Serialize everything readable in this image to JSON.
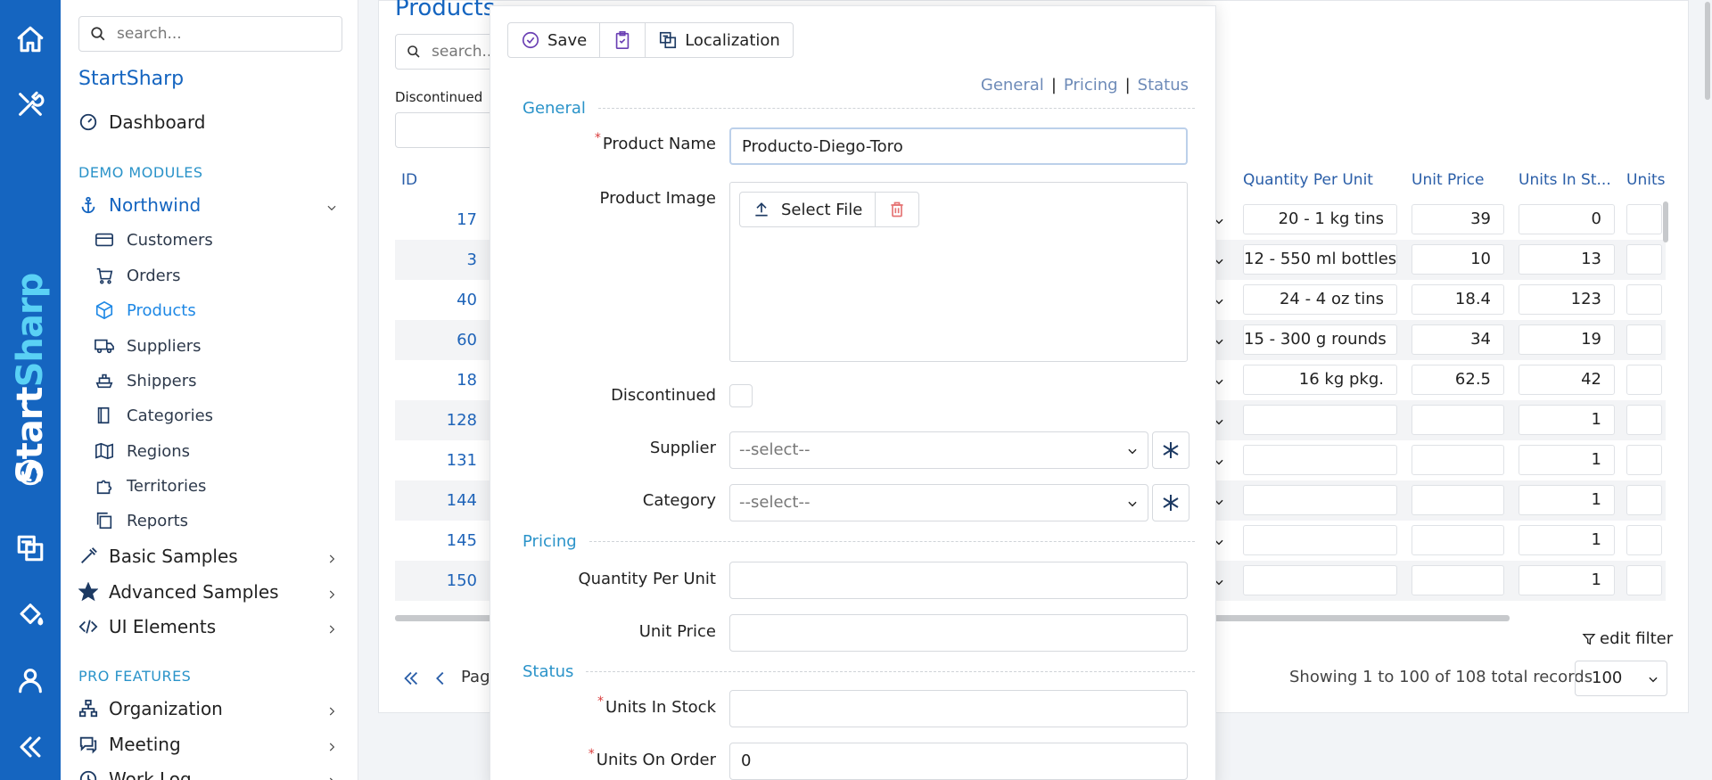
{
  "rail": {
    "brand_part1": "Start",
    "brand_part2": "Sharp",
    "icons": [
      "home-icon",
      "tools-icon",
      "translate-icon",
      "paint-bucket-icon",
      "user-icon",
      "collapse-icon"
    ]
  },
  "sidebar": {
    "search_placeholder": "search...",
    "brand": "StartSharp",
    "dashboard": "Dashboard",
    "section_demo": "DEMO MODULES",
    "northwind": "Northwind",
    "sub_items": [
      {
        "label": "Customers",
        "icon": "credit-card-icon"
      },
      {
        "label": "Orders",
        "icon": "cart-icon"
      },
      {
        "label": "Products",
        "icon": "box-icon"
      },
      {
        "label": "Suppliers",
        "icon": "truck-icon"
      },
      {
        "label": "Shippers",
        "icon": "ship-icon"
      },
      {
        "label": "Categories",
        "icon": "book-icon"
      },
      {
        "label": "Regions",
        "icon": "map-icon"
      },
      {
        "label": "Territories",
        "icon": "puzzle-icon"
      },
      {
        "label": "Reports",
        "icon": "copy-icon"
      }
    ],
    "basic_samples": "Basic Samples",
    "advanced_samples": "Advanced Samples",
    "ui_elements": "UI Elements",
    "section_pro": "PRO FEATURES",
    "organization": "Organization",
    "meeting": "Meeting",
    "work_log": "Work Log"
  },
  "grid": {
    "title": "Products",
    "search_placeholder": "search...",
    "filter_label": "Discontinued",
    "columns": {
      "id": "ID",
      "qpu": "Quantity Per Unit",
      "price": "Unit Price",
      "stock": "Units In St...",
      "units": "Units"
    },
    "rows": [
      {
        "id": "17",
        "qpu": "20 - 1 kg tins",
        "price": "39",
        "stock": "0"
      },
      {
        "id": "3",
        "qpu": "12 - 550 ml bottles",
        "price": "10",
        "stock": "13"
      },
      {
        "id": "40",
        "qpu": "24 - 4 oz tins",
        "price": "18.4",
        "stock": "123"
      },
      {
        "id": "60",
        "qpu": "15 - 300 g rounds",
        "price": "34",
        "stock": "19"
      },
      {
        "id": "18",
        "qpu": "16 kg pkg.",
        "price": "62.5",
        "stock": "42"
      },
      {
        "id": "128",
        "qpu": "",
        "price": "",
        "stock": "1"
      },
      {
        "id": "131",
        "qpu": "",
        "price": "",
        "stock": "1"
      },
      {
        "id": "144",
        "qpu": "",
        "price": "",
        "stock": "1"
      },
      {
        "id": "145",
        "qpu": "",
        "price": "",
        "stock": "1"
      },
      {
        "id": "150",
        "qpu": "",
        "price": "",
        "stock": "1"
      }
    ],
    "edit_filter": "edit filter",
    "pager_label": "Pag",
    "showing": "Showing 1 to 100 of 108 total records",
    "page_size": "100"
  },
  "dialog": {
    "toolbar": {
      "save": "Save",
      "localization": "Localization"
    },
    "links": {
      "general": "General",
      "pricing": "Pricing",
      "status": "Status",
      "sep": "|"
    },
    "categories": {
      "general": "General",
      "pricing": "Pricing",
      "status": "Status"
    },
    "fields": {
      "product_name_label": "Product Name",
      "product_name_value": "Producto-Diego-Toro",
      "product_image_label": "Product Image",
      "select_file": "Select File",
      "discontinued_label": "Discontinued",
      "supplier_label": "Supplier",
      "supplier_value": "--select--",
      "category_label": "Category",
      "category_value": "--select--",
      "qpu_label": "Quantity Per Unit",
      "unit_price_label": "Unit Price",
      "units_in_stock_label": "Units In Stock",
      "units_on_order_label": "Units On Order",
      "units_on_order_value": "0",
      "required_mark": "*"
    }
  }
}
